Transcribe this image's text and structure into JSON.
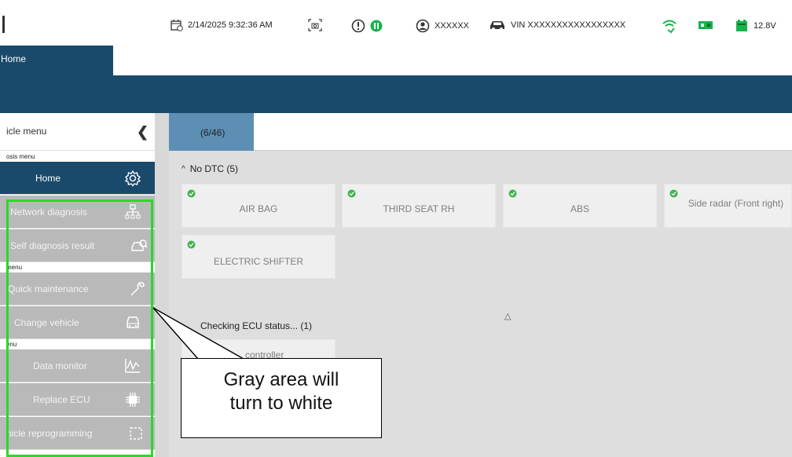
{
  "status": {
    "datetime": "2/14/2025 9:32:36 AM",
    "user": "XXXXXX",
    "vin": "VIN XXXXXXXXXXXXXXXXX",
    "voltage": "12.8V"
  },
  "tabs": {
    "home": "Home"
  },
  "sidebar": {
    "header": "icle menu",
    "sections": [
      "osis menu",
      "menu",
      "enu"
    ],
    "items": [
      {
        "label": "Home",
        "icon": "gear-icon",
        "active": true
      },
      {
        "label": "Network diagnosis",
        "icon": "network-icon"
      },
      {
        "label": "Self diagnosis result",
        "icon": "car-search-icon"
      },
      {
        "label": "Quick maintenance",
        "icon": "wrench-icon"
      },
      {
        "label": "Change vehicle",
        "icon": "vehicle-swap-icon"
      },
      {
        "label": "Data monitor",
        "icon": "waveform-icon"
      },
      {
        "label": "Replace ECU",
        "icon": "chip-icon"
      },
      {
        "label": "hicle reprogramming",
        "icon": "reprogram-icon"
      }
    ]
  },
  "content": {
    "tab_count": "(6/46)",
    "no_dtc_title": "No DTC (5)",
    "cards": [
      "AIR BAG",
      "THIRD SEAT RH",
      "ABS",
      "Side radar (Front right)",
      "ELECTRIC SHIFTER"
    ],
    "checking_title": "Checking ECU status... (1)",
    "checking_card": "controller"
  },
  "callout": {
    "line1": "Gray area will",
    "line2": "turn to white"
  },
  "colors": {
    "accent": "#1a4a6b",
    "highlight": "#29d929",
    "check": "#3fb34f",
    "gray_item": "#b9b9b9"
  }
}
